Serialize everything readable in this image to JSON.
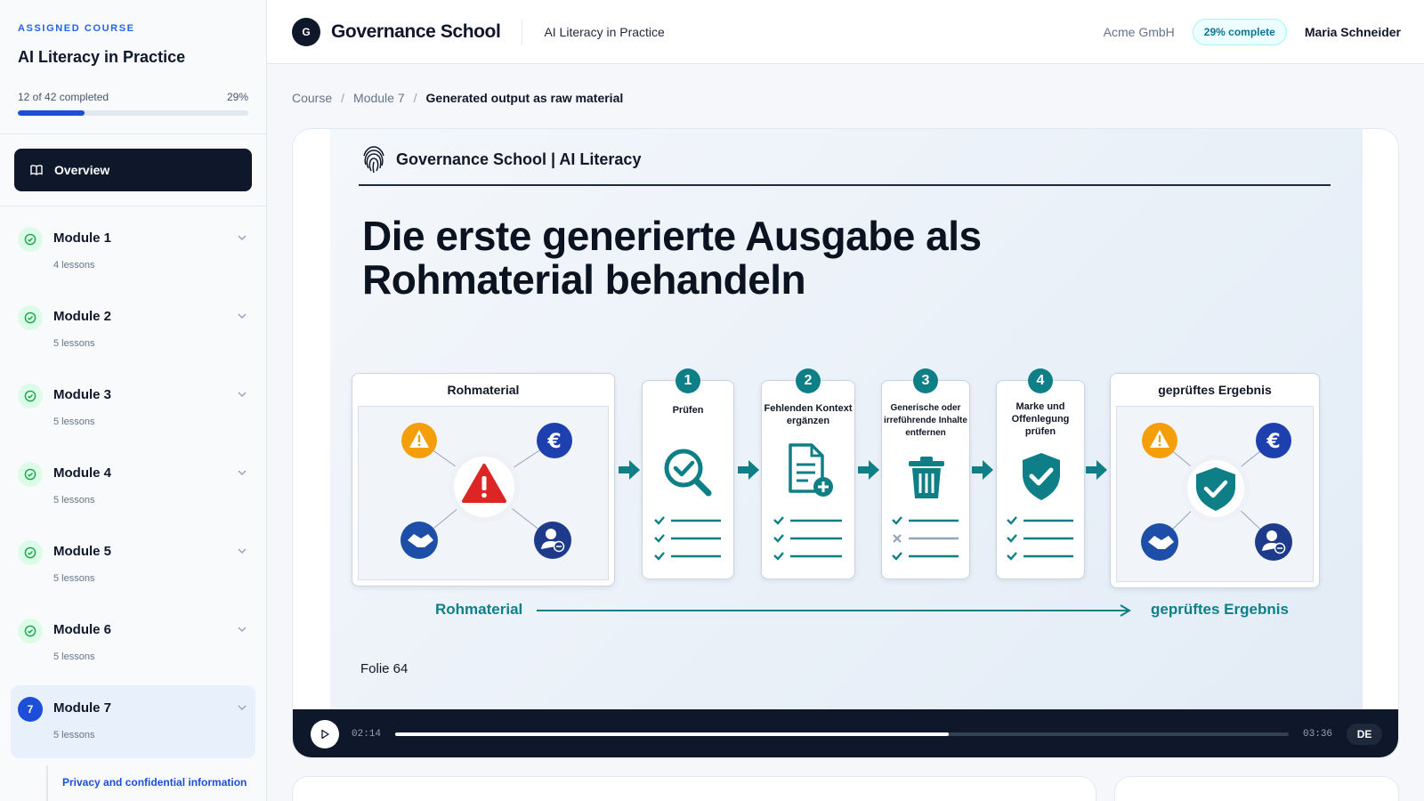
{
  "sidebar": {
    "kicker": "ASSIGNED COURSE",
    "course_title": "AI Literacy in Practice",
    "progress_text": "12 of 42 completed",
    "progress_pct": "29%",
    "progress_value": 0.29,
    "overview_label": "Overview",
    "modules": [
      {
        "name": "Module 1",
        "lessons": "4 lessons",
        "status": "completed"
      },
      {
        "name": "Module 2",
        "lessons": "5 lessons",
        "status": "completed"
      },
      {
        "name": "Module 3",
        "lessons": "5 lessons",
        "status": "completed"
      },
      {
        "name": "Module 4",
        "lessons": "5 lessons",
        "status": "completed"
      },
      {
        "name": "Module 5",
        "lessons": "5 lessons",
        "status": "completed"
      },
      {
        "name": "Module 6",
        "lessons": "5 lessons",
        "status": "completed"
      },
      {
        "name": "Module 7",
        "lessons": "5 lessons",
        "status": "active",
        "number": "7"
      }
    ],
    "active_lesson": "Privacy and confidential information"
  },
  "header": {
    "logo_letter": "G",
    "brand": "Governance School",
    "course": "AI Literacy in Practice",
    "org": "Acme GmbH",
    "complete_badge": "29% complete",
    "user": "Maria Schneider"
  },
  "breadcrumb": {
    "items": [
      "Course",
      "Module 7",
      "Generated output as raw material"
    ],
    "separator": "/"
  },
  "slide": {
    "brand": "Governance School | AI Literacy",
    "title": "Die erste generierte Ausgabe als Rohmaterial behandeln",
    "raw_label": "Rohmaterial",
    "result_label": "geprüftes Ergebnis",
    "steps": [
      {
        "num": "1",
        "label": "Prüfen"
      },
      {
        "num": "2",
        "label": "Fehlenden Kontext ergänzen"
      },
      {
        "num": "3",
        "label": "Generische oder irreführende Inhalte entfernen"
      },
      {
        "num": "4",
        "label": "Marke und Offenlegung prüfen"
      }
    ],
    "flow_left": "Rohmaterial",
    "flow_right": "geprüftes Ergebnis",
    "footer": "Folie 64",
    "accent": "#0e7f86"
  },
  "player": {
    "current_time": "02:14",
    "duration": "03:36",
    "progress": 0.62,
    "language": "DE"
  },
  "colors": {
    "accent_blue": "#1d4ed8",
    "teal": "#0e7f86",
    "dark": "#0f172a",
    "success_bg": "#dcfce7"
  }
}
